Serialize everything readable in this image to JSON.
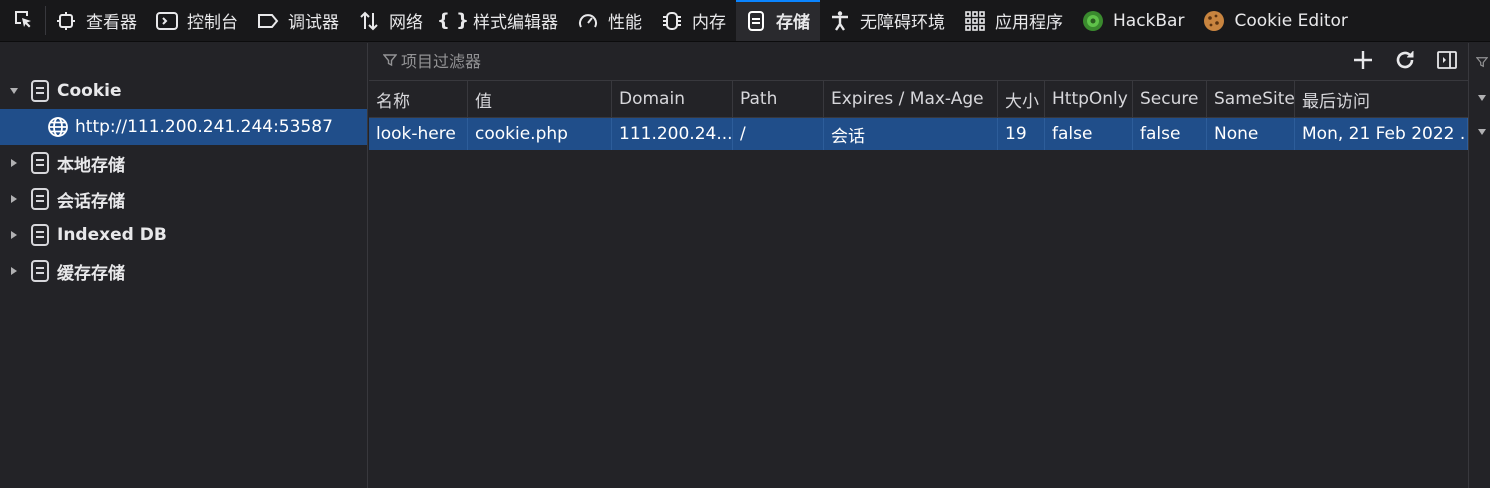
{
  "toolbar": {
    "tabs": [
      {
        "label": "查看器",
        "icon": "inspector-icon"
      },
      {
        "label": "控制台",
        "icon": "console-icon"
      },
      {
        "label": "调试器",
        "icon": "debugger-icon"
      },
      {
        "label": "网络",
        "icon": "network-icon"
      },
      {
        "label": "样式编辑器",
        "icon": "style-editor-icon"
      },
      {
        "label": "性能",
        "icon": "performance-icon"
      },
      {
        "label": "内存",
        "icon": "memory-icon"
      },
      {
        "label": "存储",
        "icon": "storage-icon",
        "active": true
      },
      {
        "label": "无障碍环境",
        "icon": "accessibility-icon"
      },
      {
        "label": "应用程序",
        "icon": "application-icon"
      },
      {
        "label": "HackBar",
        "icon": "hackbar-icon"
      },
      {
        "label": "Cookie Editor",
        "icon": "cookie-icon"
      }
    ],
    "accent_color": "#0a84ff"
  },
  "sidebar": {
    "cookie_label": "Cookie",
    "cookie_host": "http://111.200.241.244:53587",
    "local_storage": "本地存储",
    "session_storage": "会话存储",
    "indexed_db": "Indexed DB",
    "cache_storage": "缓存存储"
  },
  "filter": {
    "placeholder": "项目过滤器"
  },
  "table": {
    "columns": [
      "名称",
      "值",
      "Domain",
      "Path",
      "Expires / Max-Age",
      "大小",
      "HttpOnly",
      "Secure",
      "SameSite",
      "最后访问"
    ],
    "rows": [
      [
        "look-here",
        "cookie.php",
        "111.200.24...",
        "/",
        "会话",
        "19",
        "false",
        "false",
        "None",
        "Mon, 21 Feb 2022 ..."
      ]
    ],
    "selected_color": "#204e8a"
  }
}
